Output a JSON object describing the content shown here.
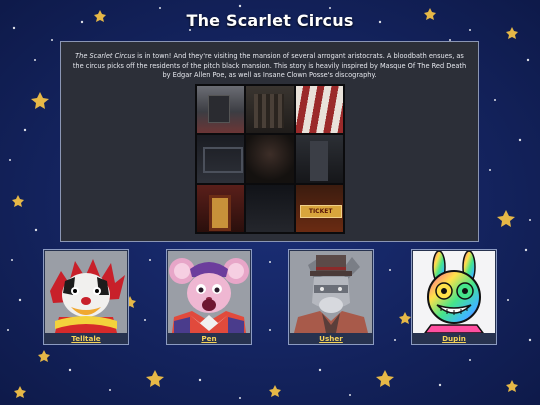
{
  "page": {
    "title": "The Scarlet Circus",
    "colors": {
      "background": "#13235c",
      "panel": "#2c2f38",
      "link": "#f5d35a"
    }
  },
  "description": {
    "italic_title": "The Scarlet Circus",
    "text": " is in town! And they're visiting the mansion of several arrogant aristocrats. A bloodbath ensues, as the circus picks off the residents of the pitch black mansion. This story is heavily inspired by Masque Of The Red Death by Edgar Allen Poe, as well as Insane Clown Posse's discography."
  },
  "collage": {
    "ticket_sign": "TICKET"
  },
  "characters": [
    {
      "name": "Telltale",
      "icon": "clown-dog-portrait"
    },
    {
      "name": "Pen",
      "icon": "jester-mouse-portrait"
    },
    {
      "name": "Usher",
      "icon": "donkey-tophat-portrait"
    },
    {
      "name": "Dupin",
      "icon": "rainbow-rabbit-portrait"
    }
  ]
}
